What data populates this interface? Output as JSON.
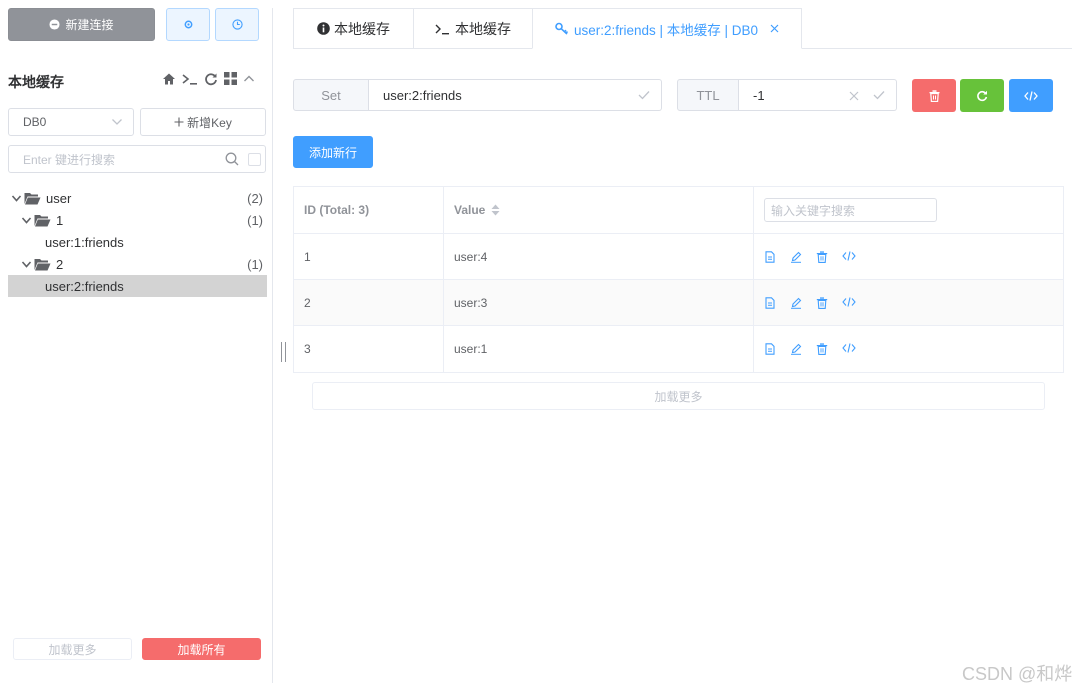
{
  "sidebar": {
    "new_connection_label": "新建连接",
    "title": "本地缓存",
    "db_select": "DB0",
    "add_key_label": "新增Key",
    "search_placeholder": "Enter 键进行搜索",
    "tree": [
      {
        "label": "user",
        "count": "(2)"
      },
      {
        "label": "1",
        "count": "(1)"
      },
      {
        "label": "user:1:friends"
      },
      {
        "label": "2",
        "count": "(1)"
      },
      {
        "label": "user:2:friends"
      }
    ],
    "load_more_label": "加载更多",
    "load_all_label": "加载所有"
  },
  "tabs": [
    {
      "label": "本地缓存",
      "icon": "info-icon"
    },
    {
      "label": "本地缓存",
      "icon": "terminal-icon"
    },
    {
      "label": "user:2:friends | 本地缓存 | DB0",
      "icon": "key-icon"
    }
  ],
  "key_editor": {
    "type_label": "Set",
    "key_name": "user:2:friends",
    "ttl_label": "TTL",
    "ttl_value": "-1"
  },
  "add_row_label": "添加新行",
  "table": {
    "headers": {
      "id": "ID (Total: 3)",
      "value": "Value"
    },
    "filter_placeholder": "输入关键字搜索",
    "rows": [
      {
        "id": "1",
        "value": "user:4"
      },
      {
        "id": "2",
        "value": "user:3"
      },
      {
        "id": "3",
        "value": "user:1"
      }
    ]
  },
  "table_load_more_label": "加载更多",
  "watermark": "CSDN @和烨",
  "colors": {
    "primary": "#409eff",
    "danger": "#f56c6c",
    "success": "#67c23a",
    "gray": "#909399"
  }
}
